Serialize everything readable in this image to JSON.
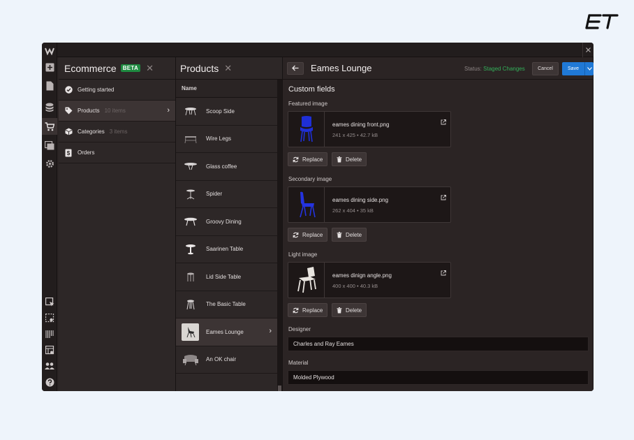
{
  "brand": {
    "logo_text": "ET"
  },
  "rail": {
    "icons": [
      "webflow-logo-icon",
      "add-icon",
      "pages-icon",
      "cms-icon",
      "ecommerce-icon",
      "assets-icon",
      "settings-icon",
      "navigator-icon",
      "preview-icon",
      "code-icon",
      "audit-icon",
      "users-icon",
      "help-icon"
    ]
  },
  "panel1": {
    "title": "Ecommerce",
    "badge": "BETA",
    "items": [
      {
        "label": "Getting started",
        "count": "",
        "icon": "check-circle-icon"
      },
      {
        "label": "Products",
        "count": "10 items",
        "icon": "tag-icon"
      },
      {
        "label": "Categories",
        "count": "3 items",
        "icon": "box-icon"
      },
      {
        "label": "Orders",
        "count": "",
        "icon": "dollar-icon"
      }
    ]
  },
  "panel2": {
    "title": "Products",
    "column_header": "Name",
    "products": [
      {
        "name": "Scoop Side"
      },
      {
        "name": "Wire Legs"
      },
      {
        "name": "Glass coffee"
      },
      {
        "name": "Spider"
      },
      {
        "name": "Groovy Dining"
      },
      {
        "name": "Saarinen Table"
      },
      {
        "name": "Lid Side Table"
      },
      {
        "name": "The Basic Table"
      },
      {
        "name": "Eames Lounge"
      },
      {
        "name": "An OK chair"
      }
    ]
  },
  "detail": {
    "title": "Eames Lounge",
    "status_label": "Status:",
    "status_value": "Staged Changes",
    "cancel_label": "Cancel",
    "save_label": "Save",
    "section_title": "Custom fields",
    "images": [
      {
        "label": "Featured image",
        "filename": "eames dining front.png",
        "meta": "241 x 425 • 42.7 kB",
        "preview_color": "#1f2fd6"
      },
      {
        "label": "Secondary image",
        "filename": "eames dining side.png",
        "meta": "262 x 404 • 35 kB",
        "preview_color": "#2433e0"
      },
      {
        "label": "Light image",
        "filename": "eames dinign angle.png",
        "meta": "400 x 400 • 40.3 kB",
        "preview_color": "#e8e4df"
      }
    ],
    "replace_label": "Replace",
    "delete_label": "Delete",
    "designer_label": "Designer",
    "designer_value": "Charles and Ray Eames",
    "material_label": "Material",
    "material_value": "Molded Plywood"
  }
}
